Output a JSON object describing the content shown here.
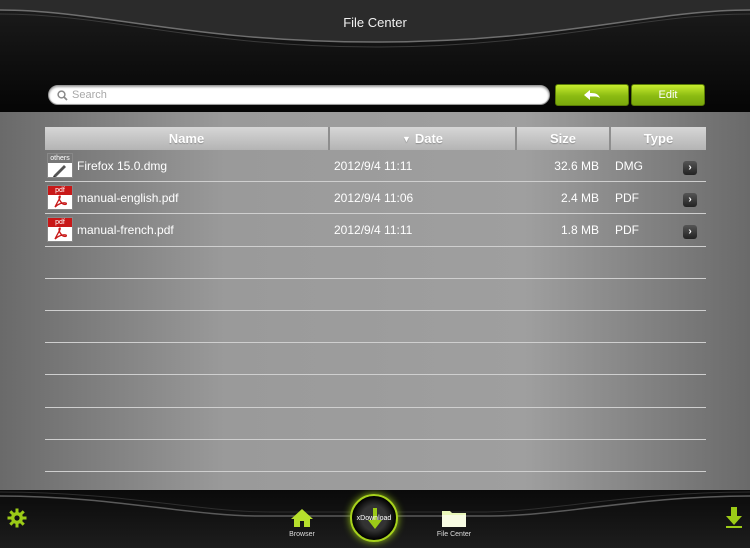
{
  "header": {
    "title": "File Center",
    "search_placeholder": "Search",
    "back_icon": "back-arrow-icon",
    "edit_label": "Edit"
  },
  "table": {
    "columns": {
      "name": "Name",
      "date": "Date",
      "size": "Size",
      "type": "Type"
    },
    "sort_indicator": "▼",
    "rows": [
      {
        "icon_tag": "others",
        "name": "Firefox 15.0.dmg",
        "date": "2012/9/4 11:11",
        "size": "32.6 MB",
        "type": "DMG"
      },
      {
        "icon_tag": "pdf",
        "name": "manual-english.pdf",
        "date": "2012/9/4 11:06",
        "size": "2.4 MB",
        "type": "PDF"
      },
      {
        "icon_tag": "pdf",
        "name": "manual-french.pdf",
        "date": "2012/9/4 11:11",
        "size": "1.8 MB",
        "type": "PDF"
      }
    ],
    "detail_glyph": "›"
  },
  "tabbar": {
    "browser_label": "Browser",
    "xdownload_label": "xDownload",
    "files_label": "File Center"
  },
  "colors": {
    "accent_green": "#9ccb17",
    "pdf_red": "#c81818"
  }
}
